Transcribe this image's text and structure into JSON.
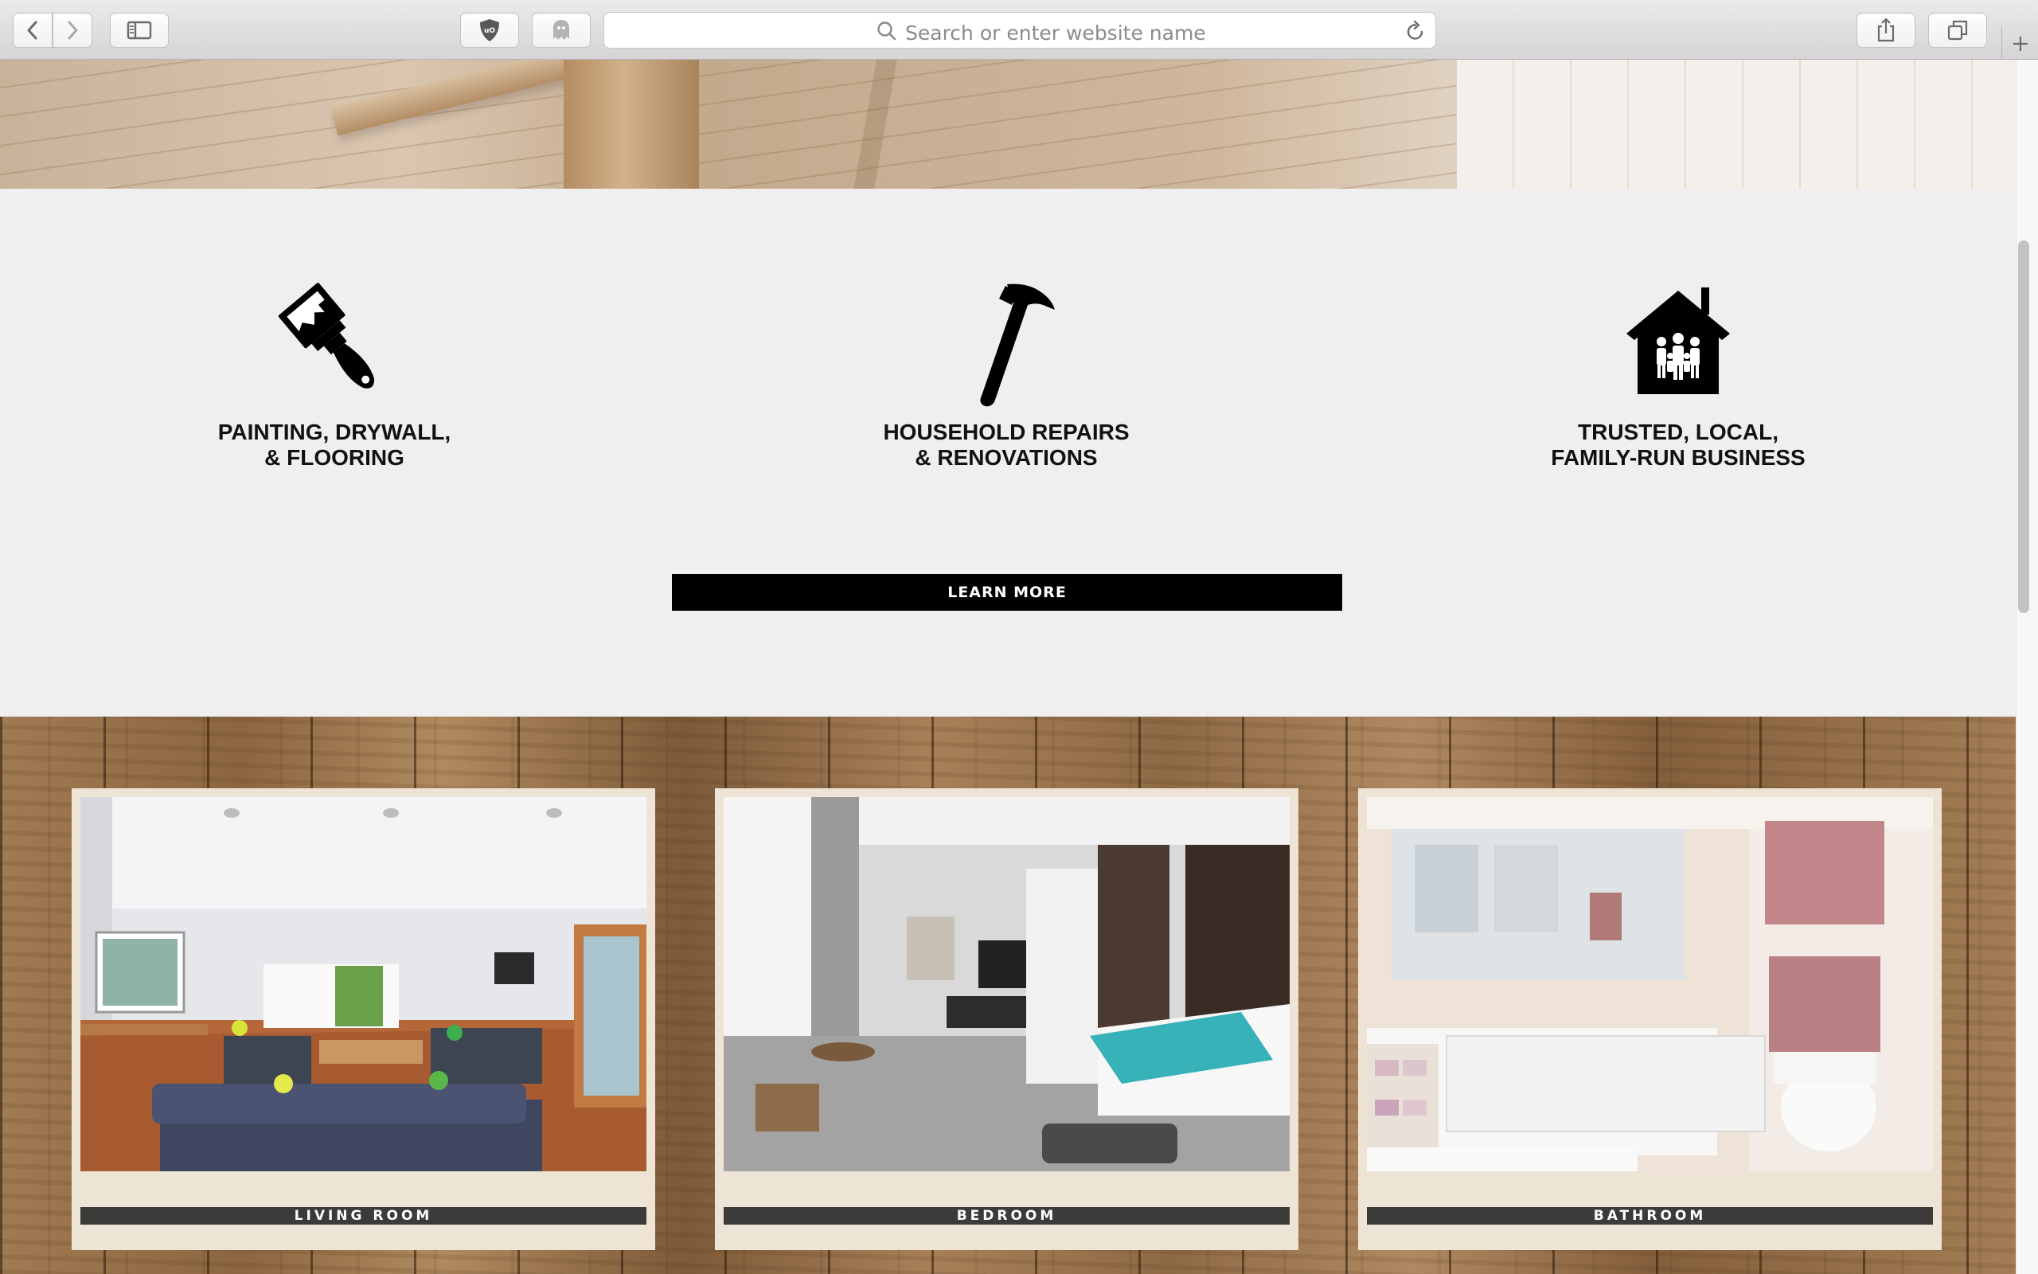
{
  "browser": {
    "address_placeholder": "Search or enter website name"
  },
  "features": [
    {
      "title": "PAINTING, DRYWALL,\n& FLOORING",
      "icon": "paintbrush-icon"
    },
    {
      "title": "HOUSEHOLD REPAIRS\n& RENOVATIONS",
      "icon": "hammer-icon"
    },
    {
      "title": "TRUSTED, LOCAL,\nFAMILY-RUN BUSINESS",
      "icon": "family-house-icon"
    }
  ],
  "cta": {
    "label": "LEARN MORE"
  },
  "rooms": [
    {
      "label": "LIVING ROOM"
    },
    {
      "label": "BEDROOM"
    },
    {
      "label": "BATHROOM"
    }
  ]
}
